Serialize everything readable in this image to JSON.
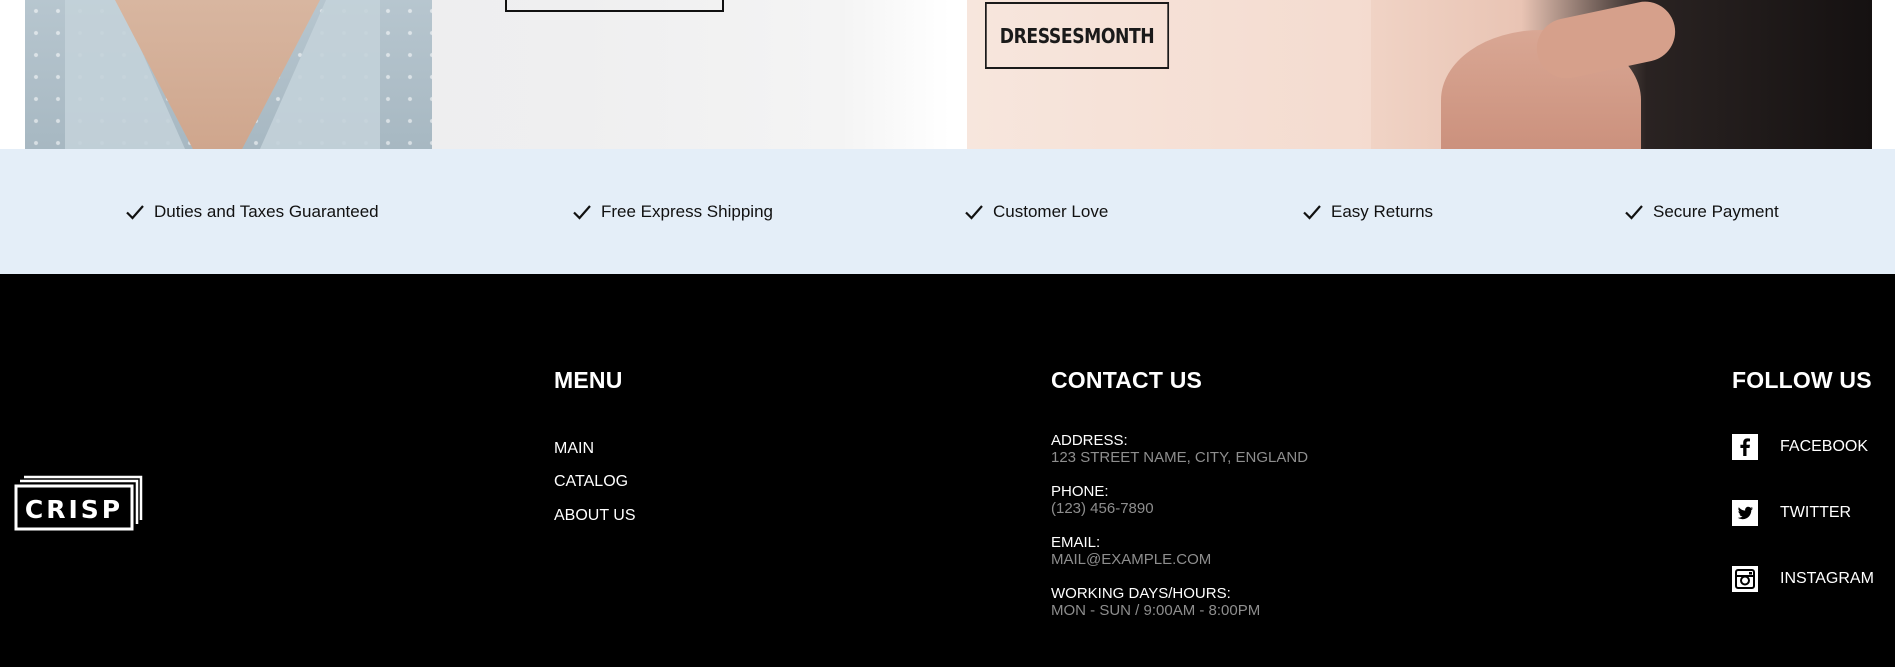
{
  "hero": {
    "cta_label": "DRESSESMONTH"
  },
  "features": [
    {
      "label": "Duties and Taxes Guaranteed",
      "icon": "check-icon"
    },
    {
      "label": "Free Express Shipping",
      "icon": "check-icon"
    },
    {
      "label": "Customer Love",
      "icon": "check-icon"
    },
    {
      "label": "Easy Returns",
      "icon": "check-icon"
    },
    {
      "label": "Secure Payment",
      "icon": "check-icon"
    }
  ],
  "footer": {
    "logo_text": "CRISP",
    "menu": {
      "title": "MENU",
      "links": [
        "MAIN",
        "CATALOG",
        "ABOUT US"
      ]
    },
    "contact": {
      "title": "CONTACT US",
      "items": [
        {
          "label": "ADDRESS:",
          "value": "123 STREET NAME, CITY, ENGLAND"
        },
        {
          "label": "PHONE:",
          "value": "(123) 456-7890"
        },
        {
          "label": "EMAIL:",
          "value": "MAIL@EXAMPLE.COM"
        },
        {
          "label": "WORKING DAYS/HOURS:",
          "value": "MON - SUN / 9:00AM - 8:00PM"
        }
      ]
    },
    "follow": {
      "title": "FOLLOW US",
      "links": [
        {
          "label": "FACEBOOK",
          "icon": "facebook-icon"
        },
        {
          "label": "TWITTER",
          "icon": "twitter-icon"
        },
        {
          "label": "INSTAGRAM",
          "icon": "instagram-icon"
        }
      ]
    }
  },
  "colors": {
    "features_bg": "#e4eef8",
    "footer_bg": "#000000",
    "muted_text": "#8e8e8e"
  }
}
